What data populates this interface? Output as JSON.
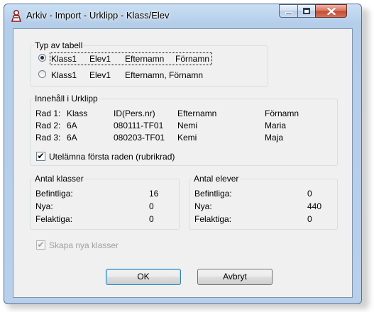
{
  "window": {
    "title": "Arkiv - Import - Urklipp - Klass/Elev"
  },
  "caption_buttons": {
    "minimize": "minimize",
    "maximize": "maximize",
    "close": "close"
  },
  "typ_av_tabell": {
    "legend": "Typ av tabell",
    "options": [
      {
        "c1": "Klass1",
        "c2": "Elev1",
        "c3": "Efternamn",
        "c4": "Förnamn",
        "selected": true
      },
      {
        "c1": "Klass1",
        "c2": "Elev1",
        "c3": "Efternamn, Förnamn",
        "selected": false
      }
    ]
  },
  "innehall": {
    "legend": "Innehåll i Urklipp",
    "rows": [
      {
        "rad": "Rad 1:",
        "klass": "Klass",
        "id": "ID(Pers.nr)",
        "efternamn": "Efternamn",
        "fornamn": "Förnamn"
      },
      {
        "rad": "Rad 2:",
        "klass": "6A",
        "id": "080111-TF01",
        "efternamn": "Nemi",
        "fornamn": "Maria"
      },
      {
        "rad": "Rad 3:",
        "klass": "6A",
        "id": "080203-TF01",
        "efternamn": "Kemi",
        "fornamn": "Maja"
      }
    ],
    "checkbox_label": "Utelämna första raden (rubrikrad)",
    "checkbox_checked": true
  },
  "antal_klasser": {
    "legend": "Antal klasser",
    "rows": [
      {
        "label": "Befintliga:",
        "value": "16"
      },
      {
        "label": "Nya:",
        "value": "0"
      },
      {
        "label": "Felaktiga:",
        "value": "0"
      }
    ]
  },
  "antal_elever": {
    "legend": "Antal elever",
    "rows": [
      {
        "label": "Befintliga:",
        "value": "0"
      },
      {
        "label": "Nya:",
        "value": "440"
      },
      {
        "label": "Felaktiga:",
        "value": "0"
      }
    ]
  },
  "skapa_nya_klasser": {
    "label": "Skapa nya klasser",
    "checked": true,
    "enabled": false
  },
  "buttons": {
    "ok": "OK",
    "avbryt": "Avbryt"
  },
  "colors": {
    "title_bar": "#b9d1ea",
    "client_bg": "#f0f0f0",
    "close_button": "#c74e38",
    "group_border": "#d5dfe5"
  }
}
